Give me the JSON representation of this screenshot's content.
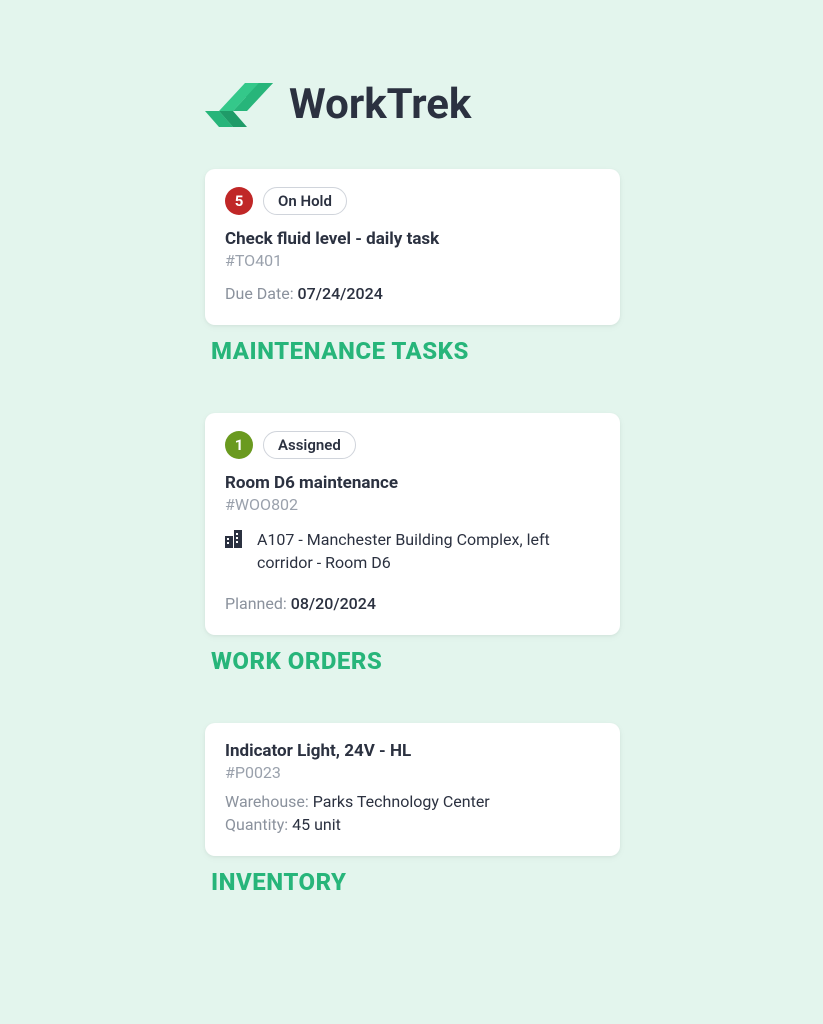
{
  "brand": {
    "name": "WorkTrek"
  },
  "sections": {
    "maintenance": {
      "heading": "MAINTENANCE TASKS",
      "card": {
        "badge_number": "5",
        "badge_color": "red",
        "status": "On Hold",
        "title": "Check fluid level -  daily task",
        "code": "#TO401",
        "due_label": "Due Date:",
        "due_value": "07/24/2024"
      }
    },
    "work_orders": {
      "heading": "WORK ORDERS",
      "card": {
        "badge_number": "1",
        "badge_color": "green",
        "status": "Assigned",
        "title": "Room D6 maintenance",
        "code": "#WOO802",
        "location": "A107 - Manchester Building Complex, left corridor - Room D6",
        "planned_label": "Planned:",
        "planned_value": "08/20/2024"
      }
    },
    "inventory": {
      "heading": "INVENTORY",
      "card": {
        "title": "Indicator Light, 24V - HL",
        "code": "#P0023",
        "warehouse_label": "Warehouse:",
        "warehouse_value": "Parks Technology Center",
        "quantity_label": "Quantity:",
        "quantity_value": "45 unit"
      }
    }
  }
}
